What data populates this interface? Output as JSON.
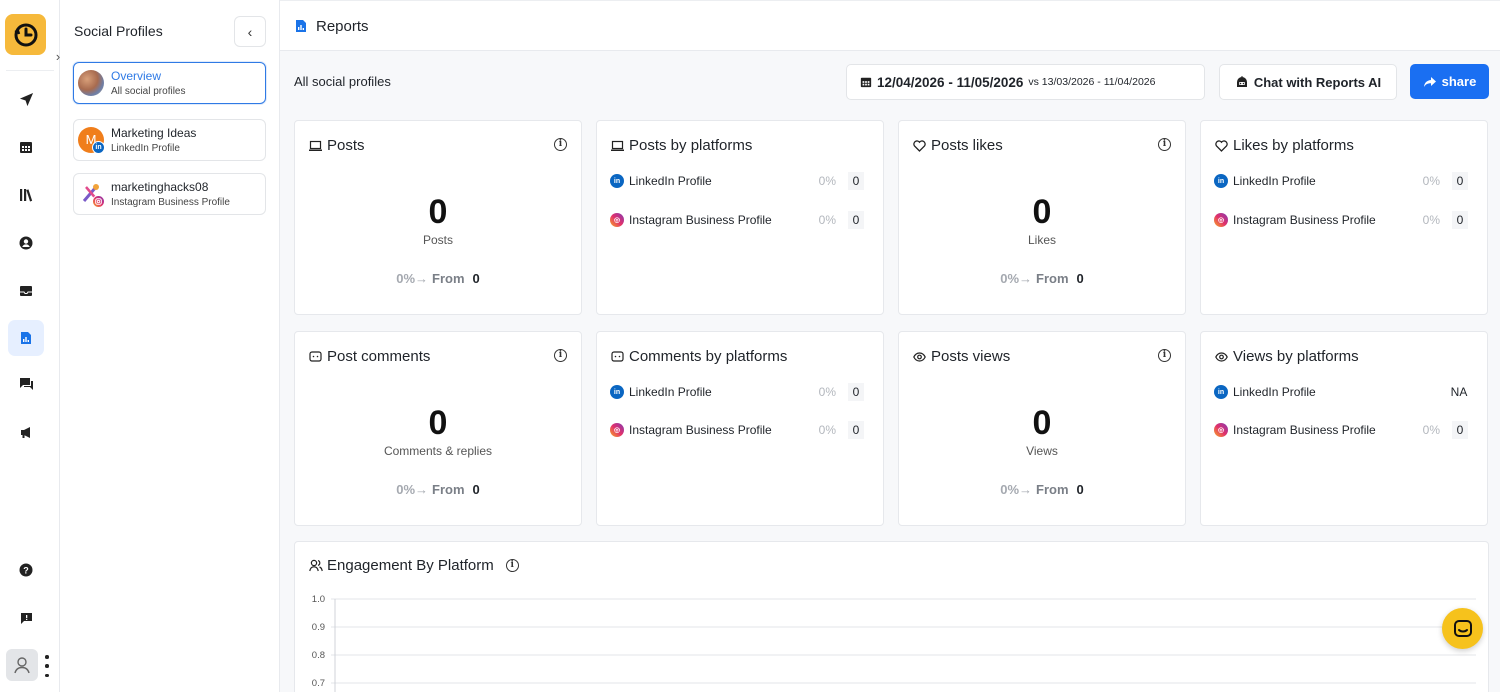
{
  "panel": {
    "title": "Social Profiles",
    "collapse_label": "‹",
    "profiles": [
      {
        "name": "Overview",
        "sub": "All social profiles",
        "active": true
      },
      {
        "name": "Marketing Ideas",
        "sub": "LinkedIn Profile",
        "avatar_letter": "M",
        "badge": "in"
      },
      {
        "name": "marketinghacks08",
        "sub": "Instagram Business Profile",
        "badge": "ig"
      }
    ]
  },
  "rail": {
    "expand_label": "›",
    "icons": [
      "send-icon",
      "calendar-icon",
      "library-icon",
      "user-circle-icon",
      "inbox-icon",
      "reports-icon",
      "chat-icon",
      "megaphone-icon",
      "help-icon",
      "feedback-icon"
    ],
    "active": "reports-icon"
  },
  "topbar": {
    "title": "Reports"
  },
  "filters": {
    "scope_label": "All social profiles",
    "date_range": "12/04/2026 - 11/05/2026",
    "compare_range": "vs 13/03/2026 - 11/04/2026",
    "chat_label": "Chat with Reports AI",
    "share_label": "share"
  },
  "cards": {
    "posts": {
      "title": "Posts",
      "value": "0",
      "label": "Posts",
      "pct": "0%",
      "arrow": "→",
      "from_label": "From",
      "from_value": "0"
    },
    "posts_platforms": {
      "title": "Posts by platforms",
      "rows": [
        {
          "name": "LinkedIn Profile",
          "pct": "0%",
          "value": "0"
        },
        {
          "name": "Instagram Business Profile",
          "pct": "0%",
          "value": "0"
        }
      ]
    },
    "likes": {
      "title": "Posts likes",
      "value": "0",
      "label": "Likes",
      "pct": "0%",
      "arrow": "→",
      "from_label": "From",
      "from_value": "0"
    },
    "likes_platforms": {
      "title": "Likes by platforms",
      "rows": [
        {
          "name": "LinkedIn Profile",
          "pct": "0%",
          "value": "0"
        },
        {
          "name": "Instagram Business Profile",
          "pct": "0%",
          "value": "0"
        }
      ]
    },
    "comments": {
      "title": "Post comments",
      "value": "0",
      "label": "Comments & replies",
      "pct": "0%",
      "arrow": "→",
      "from_label": "From",
      "from_value": "0"
    },
    "comments_platforms": {
      "title": "Comments by platforms",
      "rows": [
        {
          "name": "LinkedIn Profile",
          "pct": "0%",
          "value": "0"
        },
        {
          "name": "Instagram Business Profile",
          "pct": "0%",
          "value": "0"
        }
      ]
    },
    "views": {
      "title": "Posts views",
      "value": "0",
      "label": "Views",
      "pct": "0%",
      "arrow": "→",
      "from_label": "From",
      "from_value": "0"
    },
    "views_platforms": {
      "title": "Views by platforms",
      "rows": [
        {
          "name": "LinkedIn Profile",
          "pct": "",
          "value": "NA"
        },
        {
          "name": "Instagram Business Profile",
          "pct": "0%",
          "value": "0"
        }
      ]
    }
  },
  "engagement": {
    "title": "Engagement By Platform",
    "y_ticks": [
      "1.0",
      "0.9",
      "0.8",
      "0.7"
    ]
  },
  "colors": {
    "accent": "#1a6ff2",
    "brand_yellow": "#f6b93b",
    "linkedin": "#0a66c2"
  }
}
